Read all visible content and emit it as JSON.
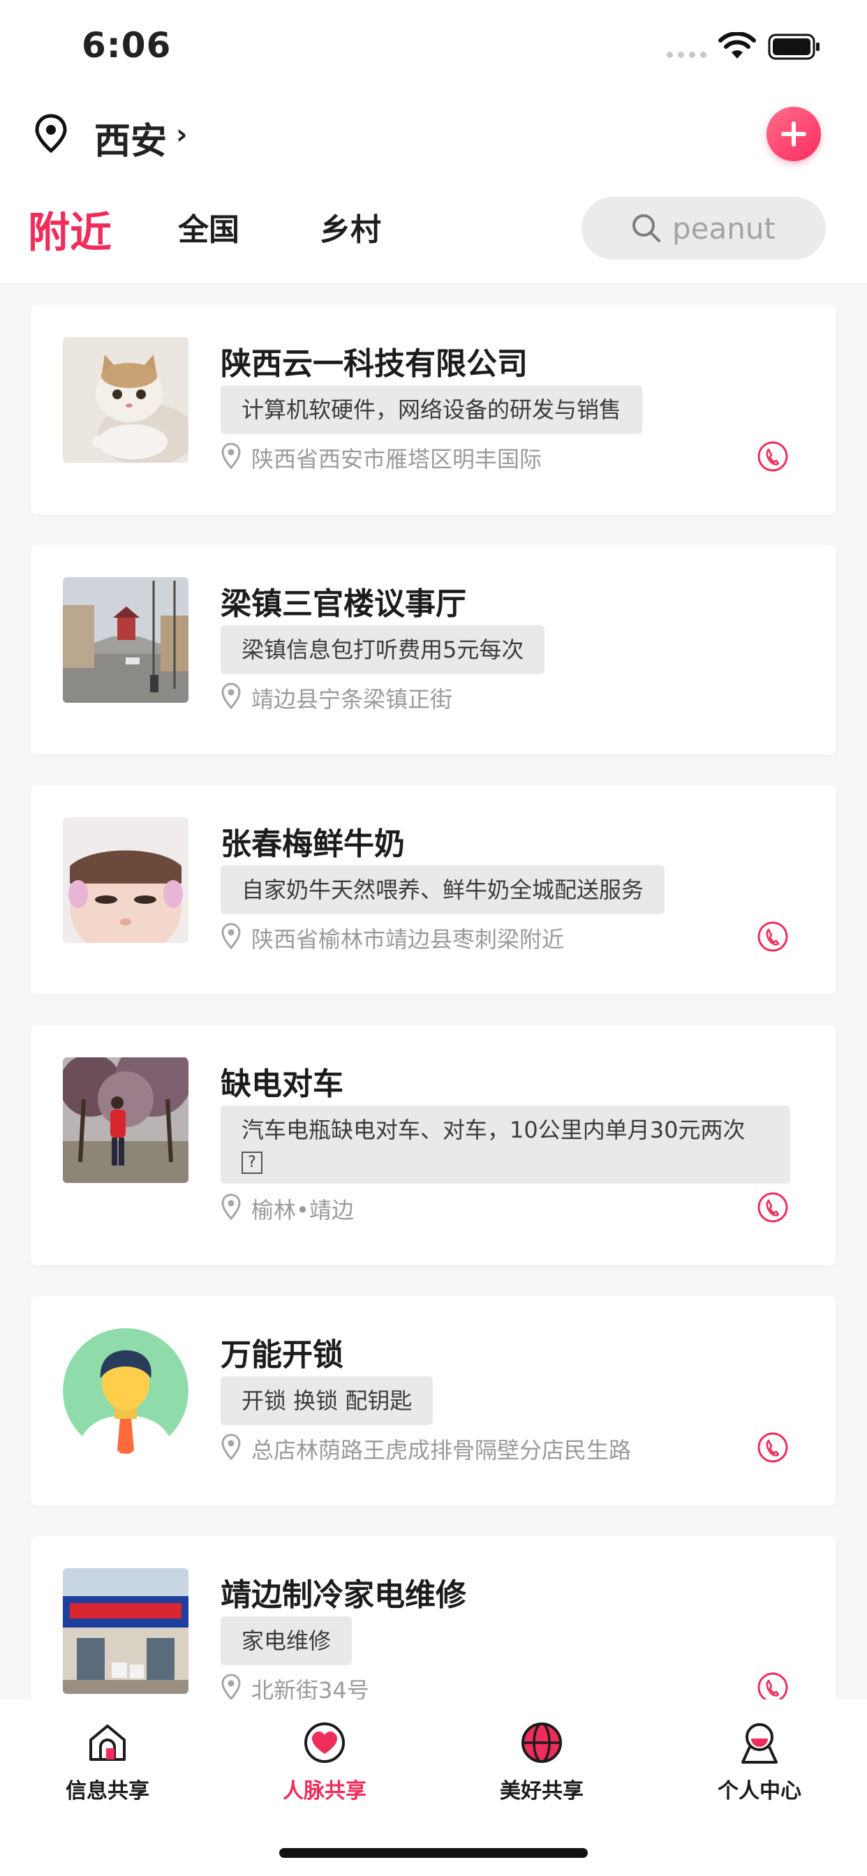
{
  "status_bar": {
    "time": "6:06"
  },
  "location": {
    "city": "西安",
    "chevron": "›"
  },
  "tabs": [
    {
      "label": "附近",
      "active": true
    },
    {
      "label": "全国",
      "active": false
    },
    {
      "label": "乡村",
      "active": false
    }
  ],
  "search": {
    "placeholder": "peanut",
    "value": ""
  },
  "items": [
    {
      "title": "陕西云一科技有限公司",
      "tag": "计算机软硬件，网络设备的研发与销售",
      "address": "陕西省西安市雁塔区明丰国际",
      "has_phone": true,
      "thumb": "kitten-photo"
    },
    {
      "title": "梁镇三官楼议事厅",
      "tag": "梁镇信息包打听费用5元每次",
      "address": "靖边县宁条梁镇正街",
      "has_phone": false,
      "thumb": "street-photo"
    },
    {
      "title": "张春梅鲜牛奶",
      "tag": "自家奶牛天然喂养、鲜牛奶全城配送服务",
      "address": "陕西省榆林市靖边县枣刺梁附近",
      "has_phone": true,
      "thumb": "child-photo"
    },
    {
      "title": "缺电对车",
      "tag_line1": "汽车电瓶缺电对车、对车，10公里内单月30元两次",
      "tag_line2": "?",
      "address": "榆林•靖边",
      "has_phone": true,
      "thumb": "tree-person-photo"
    },
    {
      "title": "万能开锁",
      "tag": "开锁 换锁 配钥匙",
      "address": "总店林荫路王虎成排骨隔壁分店民生路",
      "has_phone": true,
      "thumb": "avatar-illustration"
    },
    {
      "title": "靖边制冷家电维修",
      "tag": "家电维修",
      "address": "北新街34号",
      "has_phone": true,
      "thumb": "shopfront-photo"
    }
  ],
  "tabbar": [
    {
      "label": "信息共享",
      "icon": "house-icon",
      "active": false
    },
    {
      "label": "人脉共享",
      "icon": "heart-icon",
      "active": true
    },
    {
      "label": "美好共享",
      "icon": "globe-icon",
      "active": false
    },
    {
      "label": "个人中心",
      "icon": "person-icon",
      "active": false
    }
  ],
  "colors": {
    "accent": "#ef2d5a",
    "tag_bg": "#e9e9e9",
    "muted_text": "#9a9a9a"
  }
}
